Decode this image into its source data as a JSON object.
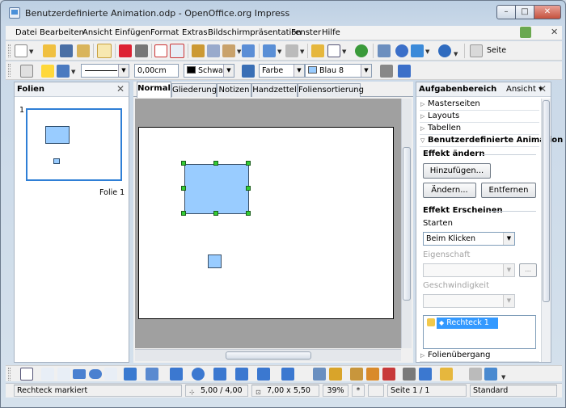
{
  "window": {
    "title": "Benutzerdefinierte Animation.odp - OpenOffice.org Impress"
  },
  "menubar": {
    "items": [
      "Datei",
      "Bearbeiten",
      "Ansicht",
      "Einfügen",
      "Format",
      "Extras",
      "Bildschirmpräsentation",
      "Fenster",
      "Hilfe"
    ]
  },
  "toolbar": {
    "seite_label": "Seite",
    "line_width": "0,00cm",
    "line_color": "Schwarz",
    "area_style": "Farbe",
    "area_color": "Blau 8",
    "colors": {
      "line": "#000000",
      "fill": "#99ccff"
    }
  },
  "slides_panel": {
    "title": "Folien",
    "slide_number": "1",
    "slide_label": "Folie 1"
  },
  "view_tabs": [
    "Normal",
    "Gliederung",
    "Notizen",
    "Handzettel",
    "Foliensortierung"
  ],
  "task_pane": {
    "title": "Aufgabenbereich",
    "view_menu": "Ansicht",
    "sections": [
      "Masterseiten",
      "Layouts",
      "Tabellen",
      "Benutzerdefinierte Animation"
    ],
    "effect_change_header": "Effekt ändern",
    "add_button": "Hinzufügen...",
    "change_button": "Ändern...",
    "remove_button": "Entfernen",
    "effect_header": "Effekt Erscheinen",
    "start_label": "Starten",
    "start_value": "Beim Klicken",
    "property_label": "Eigenschaft",
    "property_more": "...",
    "speed_label": "Geschwindigkeit",
    "animation_entry": "Rechteck 1",
    "transition_section": "Folienübergang"
  },
  "statusbar": {
    "message": "Rechteck markiert",
    "position": "5,00 / 4,00",
    "size": "7,00 x 5,50",
    "zoom": "39%",
    "modified": "*",
    "page": "Seite 1 / 1",
    "layout": "Standard"
  }
}
